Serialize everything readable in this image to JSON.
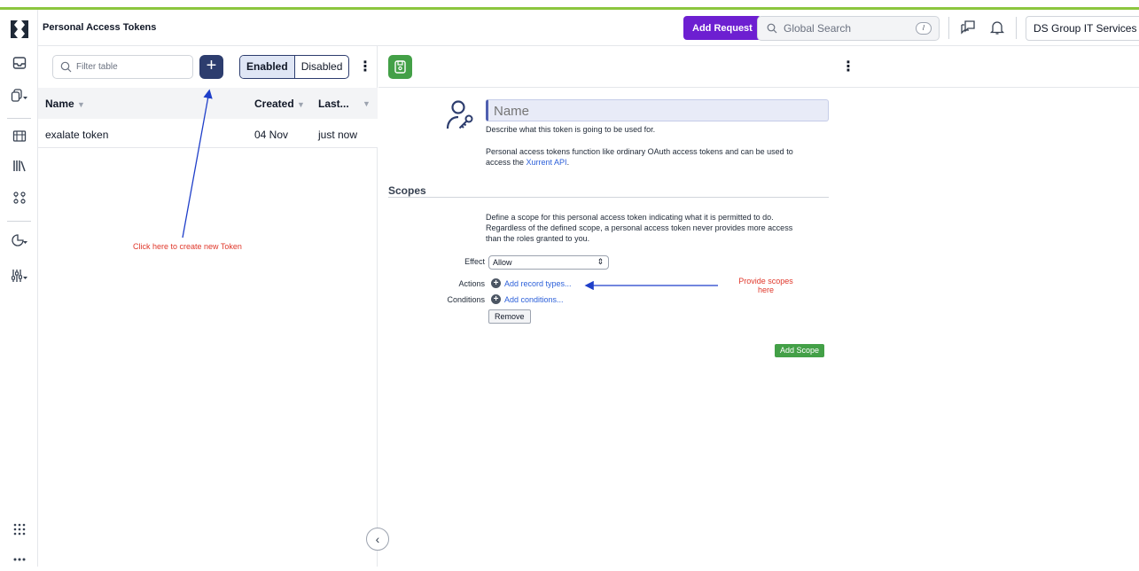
{
  "header": {
    "title": "Personal Access Tokens",
    "add_request_label": "Add Request",
    "search_placeholder": "Global Search",
    "search_shortcut": "/",
    "account_name": "DS Group IT Services"
  },
  "list": {
    "filter_placeholder": "Filter table",
    "add_label": "+",
    "toggle": {
      "enabled": "Enabled",
      "disabled": "Disabled",
      "active": "Enabled"
    },
    "columns": [
      "Name",
      "Created",
      "Last..."
    ],
    "rows": [
      {
        "name": "exalate token",
        "created": "04 Nov",
        "last": "just now"
      }
    ]
  },
  "annotations": {
    "new_token": "Click here to create new Token",
    "scopes_line1": "Provide scopes",
    "scopes_line2": "here",
    "arrow_color": "#1f3fc9",
    "text_color": "#e0382b"
  },
  "form": {
    "name_placeholder": "Name",
    "name_help": "Describe what this token is going to be used for.",
    "info_line1": "Personal access tokens function like ordinary OAuth access tokens and can be used to",
    "info_line2_prefix": "access the ",
    "info_link": "Xurrent API",
    "info_line2_suffix": ".",
    "scopes_heading": "Scopes",
    "scope_help_line1": "Define a scope for this personal access token indicating what it is permitted to do.",
    "scope_help_line2": "Regardless of the defined scope, a personal access token never provides more access",
    "scope_help_line3": "than the roles granted to you.",
    "effect_label": "Effect",
    "effect_value": "Allow",
    "actions_label": "Actions",
    "actions_link": "Add record types...",
    "conditions_label": "Conditions",
    "conditions_link": "Add conditions...",
    "remove_label": "Remove",
    "add_scope_label": "Add Scope"
  },
  "colors": {
    "brand_stripe": "#8cc63f",
    "add_request": "#6d1fd1",
    "primary_dark": "#2d3d6e",
    "success": "#43a047"
  }
}
